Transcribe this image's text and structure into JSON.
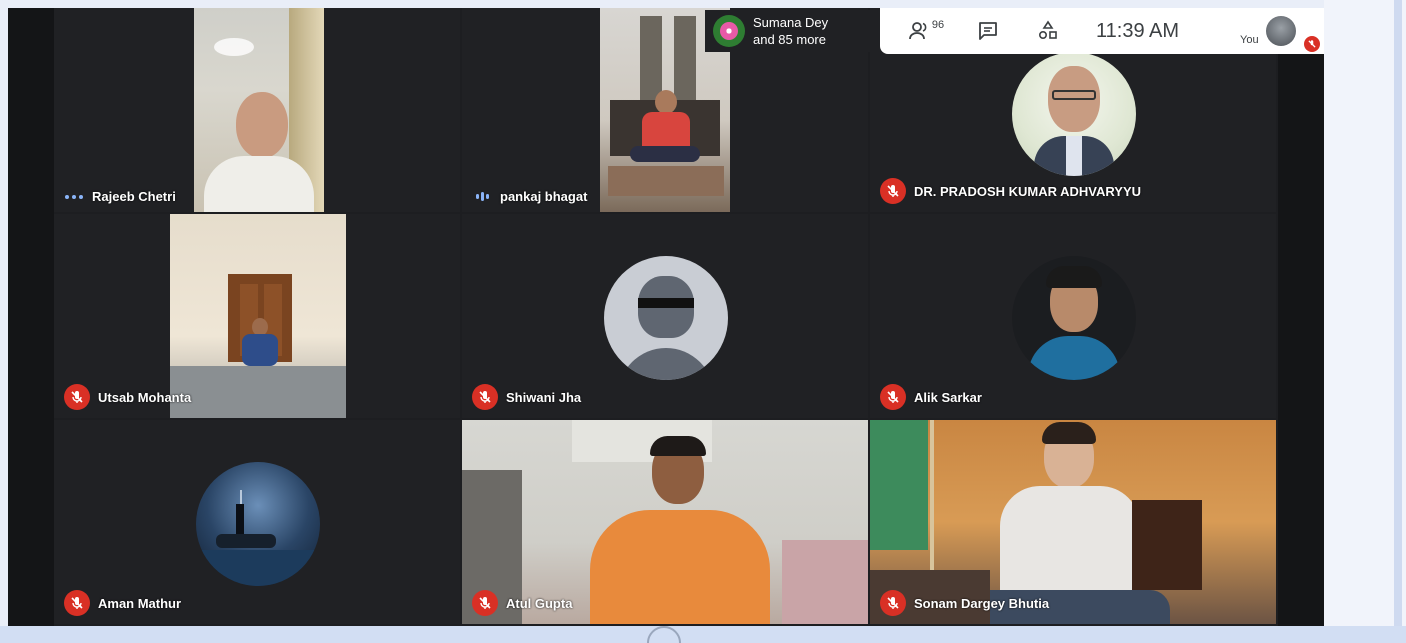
{
  "window": {
    "colors": {
      "background": "#202124",
      "accent": "#8ab4f8",
      "muted": "#d93025"
    }
  },
  "top_bar": {
    "pinned_presenter": {
      "line1": "Sumana Dey",
      "line2": "and 85 more"
    },
    "participant_count": "96",
    "chat_icon": "chat-icon",
    "activities_icon": "activities-icon",
    "time": "11:39 AM",
    "self_label": "You"
  },
  "participants": [
    {
      "name": "Rajeeb Chetri",
      "mic": "speaking-dots",
      "kind": "video"
    },
    {
      "name": "pankaj bhagat",
      "mic": "speaking-bars",
      "kind": "video"
    },
    {
      "name": "DR. PRADOSH KUMAR ADHVARYYU",
      "mic": "muted",
      "kind": "photo"
    },
    {
      "name": "Utsab Mohanta",
      "mic": "muted",
      "kind": "video"
    },
    {
      "name": "Shiwani Jha",
      "mic": "muted",
      "kind": "avatar"
    },
    {
      "name": "Alik Sarkar",
      "mic": "muted",
      "kind": "photo"
    },
    {
      "name": "Aman Mathur",
      "mic": "muted",
      "kind": "photo"
    },
    {
      "name": "Atul Gupta",
      "mic": "muted",
      "kind": "video"
    },
    {
      "name": "Sonam Dargey Bhutia",
      "mic": "muted",
      "kind": "video"
    }
  ]
}
